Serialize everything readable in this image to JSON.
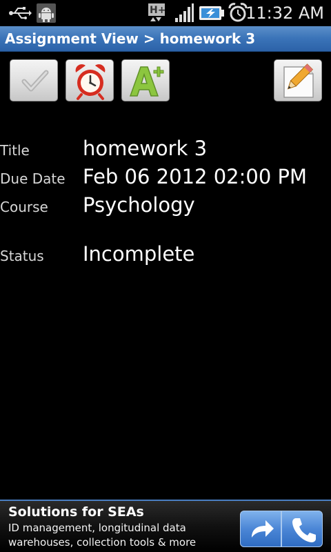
{
  "status_bar": {
    "time": "11:32 AM",
    "network_type": "H+",
    "icons": [
      "usb-icon",
      "android-debug-icon",
      "data-network-icon",
      "signal-icon",
      "battery-charging-icon",
      "alarm-icon"
    ]
  },
  "title_bar": {
    "title": "Assignment View > homework 3"
  },
  "toolbar": {
    "buttons": [
      {
        "icon": "checkmark-icon",
        "label": "Mark complete"
      },
      {
        "icon": "alarm-clock-icon",
        "label": "Reminder"
      },
      {
        "icon": "grade-icon",
        "label": "Grade"
      },
      {
        "icon": "edit-pencil-icon",
        "label": "Edit"
      }
    ]
  },
  "details": {
    "title_label": "Title",
    "title_value": "homework 3",
    "due_label": "Due Date",
    "due_value": "Feb 06 2012 02:00 PM",
    "course_label": "Course",
    "course_value": "Psychology",
    "status_label": "Status",
    "status_value": "Incomplete"
  },
  "ad": {
    "title": "Solutions for SEAs",
    "line1": "ID management, longitudinal data",
    "line2": "warehouses, collection tools & more",
    "buttons": [
      "share-arrow-icon",
      "phone-icon"
    ]
  },
  "colors": {
    "title_bar": "#3a73b8",
    "background": "#000000",
    "ad_accent": "#4b86d6",
    "grade_green": "#8cc63f",
    "alarm_red": "#d62d20"
  }
}
